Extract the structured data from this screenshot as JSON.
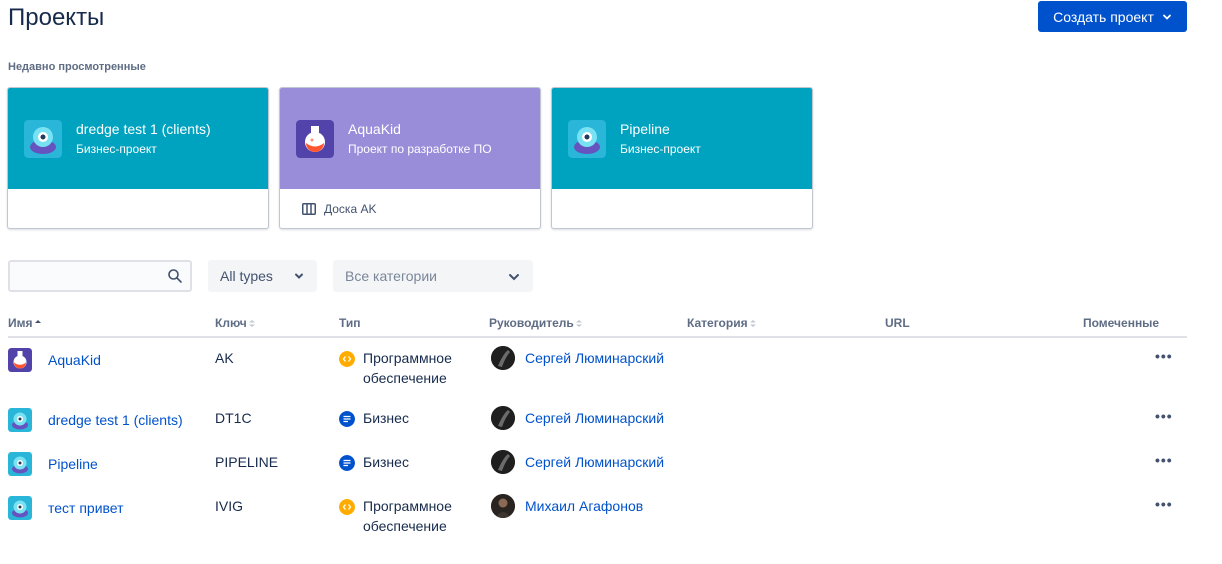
{
  "page": {
    "title": "Проекты",
    "create_button": "Создать проект"
  },
  "recent": {
    "label": "Недавно просмотренные",
    "cards": [
      {
        "title": "dredge test 1 (clients)",
        "subtitle": "Бизнес-проект",
        "color": "#00a3bf",
        "icon": "robot-avatar-icon",
        "link": ""
      },
      {
        "title": "AquaKid",
        "subtitle": "Проект по разработке ПО",
        "color": "#998dd9",
        "icon": "potion-avatar-icon",
        "link": "Доска AK"
      },
      {
        "title": "Pipeline",
        "subtitle": "Бизнес-проект",
        "color": "#00a3bf",
        "icon": "robot-avatar-icon",
        "link": ""
      }
    ]
  },
  "filters": {
    "search_placeholder": "",
    "types": "All types",
    "categories": "Все категории"
  },
  "table": {
    "columns": [
      "Имя",
      "Ключ",
      "Тип",
      "Руководитель",
      "Категория",
      "URL",
      "Помеченные"
    ],
    "rows": [
      {
        "name": "AquaKid",
        "key": "AK",
        "type": "Программное обеспечение",
        "type_kind": "software",
        "lead": "Сергей Люминарский",
        "icon": "potion-avatar-icon"
      },
      {
        "name": "dredge test 1 (clients)",
        "key": "DT1C",
        "type": "Бизнес",
        "type_kind": "business",
        "lead": "Сергей Люминарский",
        "icon": "robot-avatar-icon"
      },
      {
        "name": "Pipeline",
        "key": "PIPELINE",
        "type": "Бизнес",
        "type_kind": "business",
        "lead": "Сергей Люминарский",
        "icon": "robot-avatar-icon"
      },
      {
        "name": "тест привет",
        "key": "IVIG",
        "type": "Программное обеспечение",
        "type_kind": "software",
        "lead": "Михаил Агафонов",
        "icon": "robot-avatar-icon"
      }
    ],
    "more_label": "•••"
  },
  "colors": {
    "accent": "#0052cc",
    "business_type": "#0052cc",
    "software_type": "#ffab00"
  }
}
